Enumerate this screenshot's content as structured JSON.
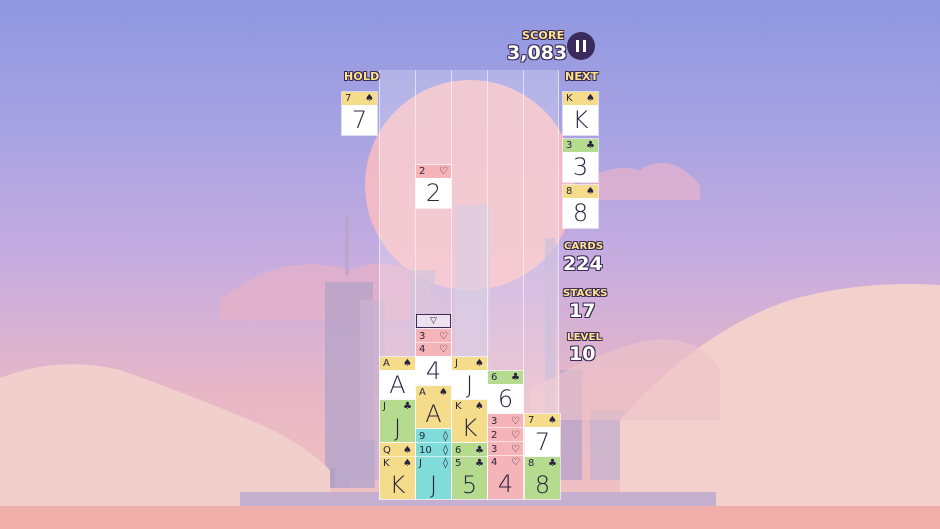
{
  "hud": {
    "score_label": "SCORE",
    "score_value": "3,083",
    "hold_label": "HOLD",
    "next_label": "NEXT",
    "cards_label": "CARDS",
    "cards_value": "224",
    "stacks_label": "STACKS",
    "stacks_value": "17",
    "level_label": "LEVEL",
    "level_value": "10"
  },
  "hold_card": {
    "rank": "7",
    "suit": "♠",
    "color": "yellow"
  },
  "next_cards": [
    {
      "rank": "K",
      "suit": "♠",
      "color": "yellow"
    },
    {
      "rank": "3",
      "suit": "♣",
      "color": "green"
    },
    {
      "rank": "8",
      "suit": "♠",
      "color": "yellow"
    }
  ],
  "falling_card": {
    "rank": "2",
    "suit": "♡",
    "color": "red"
  },
  "drop_marker": "▽",
  "columns": [
    [
      {
        "rank": "A",
        "suit": "♠",
        "color": "yellow",
        "kind": "full"
      },
      {
        "rank": "J",
        "suit": "♣",
        "color": "green",
        "kind": "full"
      },
      {
        "rank": "Q",
        "suit": "♠",
        "color": "yellow",
        "kind": "small"
      },
      {
        "rank": "K",
        "suit": "♠",
        "color": "yellow",
        "kind": "full"
      }
    ],
    [
      {
        "rank": "3",
        "suit": "♡",
        "color": "red",
        "kind": "small"
      },
      {
        "rank": "4",
        "suit": "♡",
        "color": "red",
        "kind": "full"
      },
      {
        "rank": "A",
        "suit": "♠",
        "color": "yellow",
        "kind": "full"
      },
      {
        "rank": "9",
        "suit": "◊",
        "color": "teal",
        "kind": "small"
      },
      {
        "rank": "10",
        "suit": "◊",
        "color": "teal",
        "kind": "small"
      },
      {
        "rank": "J",
        "suit": "◊",
        "color": "teal",
        "kind": "full"
      }
    ],
    [
      {
        "rank": "J",
        "suit": "♠",
        "color": "yellow",
        "kind": "full"
      },
      {
        "rank": "K",
        "suit": "♠",
        "color": "yellow",
        "kind": "full"
      },
      {
        "rank": "6",
        "suit": "♣",
        "color": "green",
        "kind": "small"
      },
      {
        "rank": "5",
        "suit": "♣",
        "color": "green",
        "kind": "full"
      }
    ],
    [
      {
        "rank": "6",
        "suit": "♣",
        "color": "green",
        "kind": "full"
      },
      {
        "rank": "3",
        "suit": "♡",
        "color": "red",
        "kind": "small"
      },
      {
        "rank": "2",
        "suit": "♡",
        "color": "red",
        "kind": "small"
      },
      {
        "rank": "3",
        "suit": "♡",
        "color": "red",
        "kind": "small"
      },
      {
        "rank": "4",
        "suit": "♡",
        "color": "red",
        "kind": "full"
      }
    ],
    [
      {
        "rank": "7",
        "suit": "♠",
        "color": "yellow",
        "kind": "full"
      },
      {
        "rank": "8",
        "suit": "♣",
        "color": "green",
        "kind": "full"
      }
    ]
  ]
}
